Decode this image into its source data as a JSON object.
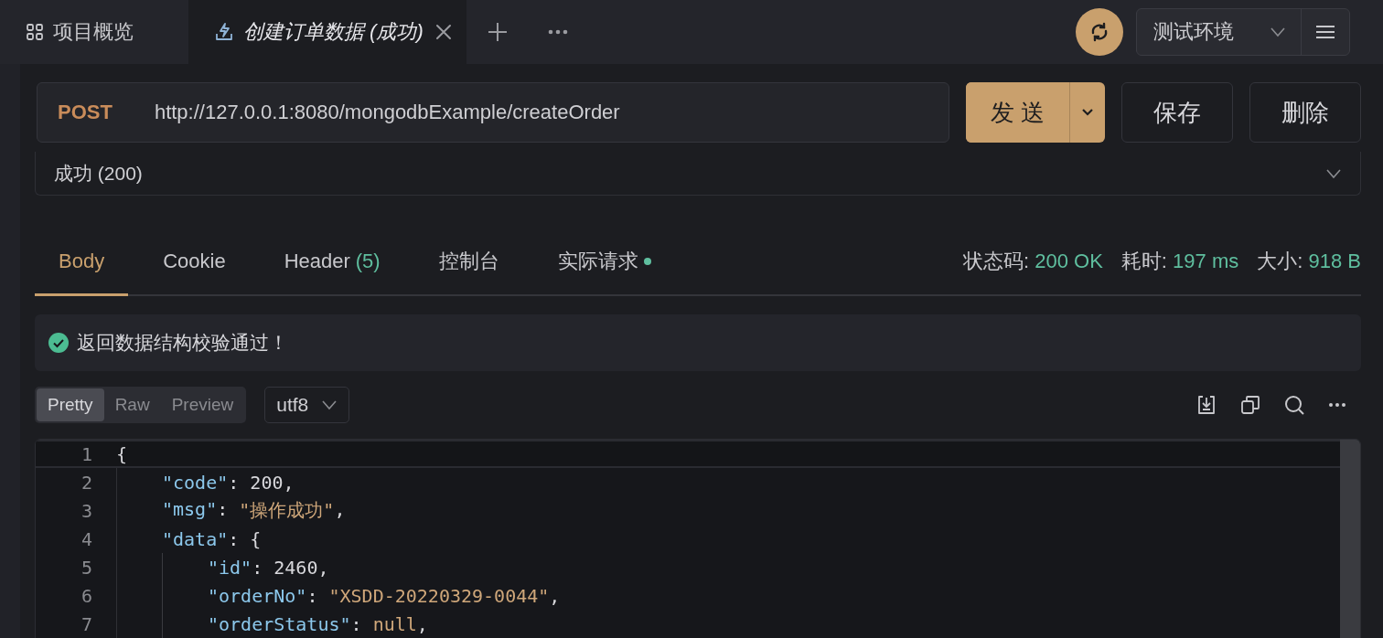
{
  "tabs": [
    {
      "label": "项目概览",
      "kind": "overview",
      "selected": false
    },
    {
      "label": "创建订单数据 (成功)",
      "kind": "request",
      "selected": true
    }
  ],
  "sync_button": {
    "on": true
  },
  "environment": {
    "value": "测试环境"
  },
  "request": {
    "method": "POST",
    "url": "http://127.0.0.1:8080/mongodbExample/createOrder"
  },
  "buttons": [
    {
      "label": "发 送",
      "kind": "primary"
    },
    {
      "label": "保存",
      "kind": "plain"
    },
    {
      "label": "删除",
      "kind": "plain"
    }
  ],
  "example_select": {
    "value": "成功 (200)"
  },
  "response_tabs": [
    {
      "label": "Body",
      "selected": true
    },
    {
      "label": "Cookie",
      "selected": false
    },
    {
      "label": "Header",
      "count": "(5)",
      "selected": false
    },
    {
      "label": "控制台",
      "selected": false
    },
    {
      "label": "实际请求",
      "dot": true,
      "selected": false
    }
  ],
  "stats": [
    {
      "label": "状态码:",
      "value": "200 OK"
    },
    {
      "label": "耗时:",
      "value": "197 ms"
    },
    {
      "label": "大小:",
      "value": "918 B"
    }
  ],
  "validation": {
    "message": "返回数据结构校验通过！",
    "passed": true
  },
  "view_modes": [
    {
      "label": "Pretty",
      "selected": true
    },
    {
      "label": "Raw",
      "selected": false
    },
    {
      "label": "Preview",
      "selected": false
    }
  ],
  "encoding": {
    "value": "utf8"
  },
  "code": [
    {
      "number": "1",
      "active": true,
      "tokens": [
        {
          "kind": "punct",
          "text": "{"
        }
      ],
      "children": [
        {
          "number": "2",
          "active": false,
          "tokens": [
            {
              "kind": "key",
              "text": "\"code\""
            },
            {
              "kind": "punct",
              "text": ": "
            },
            {
              "kind": "number",
              "text": "200"
            },
            {
              "kind": "punct",
              "text": ","
            }
          ]
        },
        {
          "number": "3",
          "active": false,
          "tokens": [
            {
              "kind": "key",
              "text": "\"msg\""
            },
            {
              "kind": "punct",
              "text": ": "
            },
            {
              "kind": "string",
              "text": "\"操作成功\""
            },
            {
              "kind": "punct",
              "text": ","
            }
          ]
        },
        {
          "number": "4",
          "active": false,
          "tokens": [
            {
              "kind": "key",
              "text": "\"data\""
            },
            {
              "kind": "punct",
              "text": ": {"
            }
          ],
          "children": [
            {
              "number": "5",
              "active": false,
              "tokens": [
                {
                  "kind": "key",
                  "text": "\"id\""
                },
                {
                  "kind": "punct",
                  "text": ": "
                },
                {
                  "kind": "number",
                  "text": "2460"
                },
                {
                  "kind": "punct",
                  "text": ","
                }
              ]
            },
            {
              "number": "6",
              "active": false,
              "tokens": [
                {
                  "kind": "key",
                  "text": "\"orderNo\""
                },
                {
                  "kind": "punct",
                  "text": ": "
                },
                {
                  "kind": "string",
                  "text": "\"XSDD-20220329-0044\""
                },
                {
                  "kind": "punct",
                  "text": ","
                }
              ]
            },
            {
              "number": "7",
              "active": false,
              "tokens": [
                {
                  "kind": "key",
                  "text": "\"orderStatus\""
                },
                {
                  "kind": "punct",
                  "text": ": "
                },
                {
                  "kind": "keyword",
                  "text": "null"
                },
                {
                  "kind": "punct",
                  "text": ","
                }
              ]
            }
          ]
        }
      ]
    }
  ]
}
